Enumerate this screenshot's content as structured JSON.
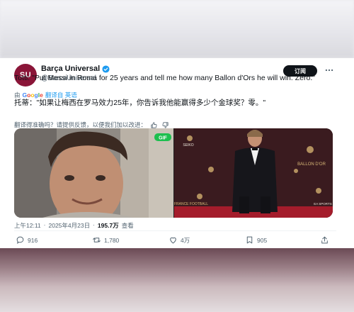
{
  "tweet": {
    "author": {
      "avatar_text": "SU",
      "display_name": "Barça Universal",
      "handle": "@BarcaUniversal"
    },
    "subscribe_label": "订阅",
    "text": "Totti: \"Put Messi in Roma for 25 years and tell me how many Ballon d'Ors he will win. Zero.\"",
    "translated_by": {
      "prefix": "由",
      "provider": "Google",
      "action": "翻译自 英语"
    },
    "translated_text": "托蒂：\"如果让梅西在罗马效力25年，你告诉我他能赢得多少个金球奖？零。\"",
    "feedback": {
      "prompt": "翻译得准确吗？请提供反馈，以便我们加以改进："
    },
    "media": {
      "left_badge": "GIF",
      "right_backdrop_text": "BALLON D'OR",
      "right_backdrop_sub": "FRANCE FOOTBALL",
      "right_brand_left": "SEIKO",
      "right_brand_right": "EA SPORTS"
    },
    "meta": {
      "time": "上午12:11",
      "separator": "·",
      "date": "2025年4月23日",
      "views_count": "195.7万",
      "views_label": "查看"
    },
    "actions": {
      "replies": "916",
      "retweets": "1,780",
      "likes": "4万",
      "bookmarks": "905"
    }
  },
  "colors": {
    "brand": "#8a1538",
    "link": "#1d9bf0",
    "verified": "#1d9bf0",
    "muted_text": "#536471",
    "carpet": "#a41c2b"
  }
}
